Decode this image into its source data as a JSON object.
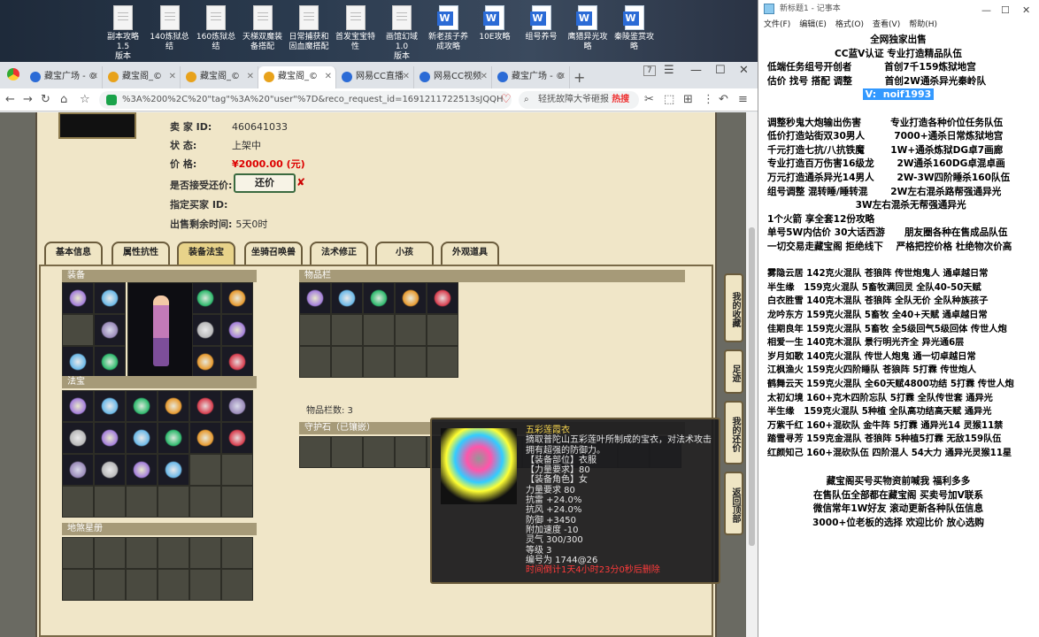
{
  "desktop_icons": [
    {
      "label": "副本攻略1.5\n版本",
      "type": "doc"
    },
    {
      "label": "140炼狱总结",
      "type": "doc"
    },
    {
      "label": "160炼狱总结",
      "type": "doc"
    },
    {
      "label": "天梯双魔装\n备搭配",
      "type": "doc"
    },
    {
      "label": "日常捕获和\n固血魔搭配",
      "type": "doc"
    },
    {
      "label": "首发宝宝特\n性",
      "type": "doc"
    },
    {
      "label": "画馆幻域1.0\n版本",
      "type": "doc"
    },
    {
      "label": "新老孩子养\n成攻略",
      "type": "word"
    },
    {
      "label": "10E攻略",
      "type": "word"
    },
    {
      "label": "组号养号",
      "type": "word"
    },
    {
      "label": "鹰猎异光攻\n略",
      "type": "word"
    },
    {
      "label": "秦陵鉴赏攻\n略",
      "type": "word"
    }
  ],
  "browser": {
    "tabs": [
      {
        "label": "藏宝广场 - ©",
        "active": false,
        "color": "#2b6bd6"
      },
      {
        "label": "藏宝阁_©",
        "active": false,
        "color": "#e8a21b"
      },
      {
        "label": "藏宝阁_©",
        "active": false,
        "color": "#e8a21b"
      },
      {
        "label": "藏宝阁_©",
        "active": true,
        "color": "#e8a21b"
      },
      {
        "label": "网易CC直播",
        "active": false,
        "color": "#2b6bd6"
      },
      {
        "label": "网易CC视频",
        "active": false,
        "color": "#2b6bd6"
      },
      {
        "label": "藏宝广场 - ©",
        "active": false,
        "color": "#2b6bd6"
      }
    ],
    "url": "%3A%200%2C%20\"tag\"%3A%20\"user\"%7D&reco_request_id=1691211722513sJQQH",
    "search_placeholder": "轻抚故障大爷砸报",
    "search_hot": "热搜",
    "counter": "7"
  },
  "listing": {
    "seller_label": "卖 家 ID:",
    "seller_id": "460641033",
    "status_label": "状 态:",
    "status": "上架中",
    "price_label": "价 格:",
    "price": "¥2000.00 (元)",
    "counter_label": "是否接受还价:",
    "counter_button": "还价",
    "buyer_label": "指定买家 ID:",
    "time_label": "出售剩余时间:",
    "time_left": "5天0时"
  },
  "game_tabs": [
    "基本信息",
    "属性抗性",
    "装备法宝",
    "坐骑召唤兽",
    "法术修正",
    "小孩",
    "外观道具"
  ],
  "active_tab": 2,
  "sections": {
    "equip": "装备",
    "fabao": "法宝",
    "jiyuan": "地煞星册",
    "items": "物品栏",
    "slot_count": "物品栏数: 3",
    "guard": "守护石（已镶嵌）"
  },
  "tooltip": {
    "name": "五彩莲霞衣",
    "desc": "摘取普陀山五彩莲叶所制成的宝衣，对法术攻击拥有超强的防御力。",
    "lines": [
      "【装备部位】衣服",
      "【力量要求】80",
      "【装备角色】女",
      "力量要求 80",
      "抗雷 +24.0%",
      "抗风 +24.0%",
      "防御 +3450",
      "附加速度 -10",
      "灵气 300/300",
      "等级 3",
      "编号为 1744@26"
    ],
    "timer": "时间倒计1天4小时23分0秒后删除"
  },
  "side_buttons": [
    "我的收藏",
    "足迹",
    "我的还价",
    "返回顶部"
  ],
  "notepad": {
    "title": "新标题1 - 记事本",
    "menu": [
      "文件(F)",
      "编辑(E)",
      "格式(O)",
      "查看(V)",
      "帮助(H)"
    ],
    "lines": [
      "全网独家出售",
      "CC蓝V认证 专业打造精品队伍",
      "低端任务组号开创者          首创7千159炼狱地宫",
      "估价 找号 搭配 调整          首创2W通杀异光秦岭队",
      "V:  noif1993",
      "",
      "调整秒鬼大炮输出伤害         专业打造各种价位任务队伍",
      "低价打造站街双30男人         7000+通杀日常炼狱地宫",
      "千元打造七抗/八抗铁魔        1W+通杀炼狱DG卓7画廊",
      "专业打造百万伤害16级龙       2W通杀160DG卓混卓画",
      "万元打造通杀异光14男人       2W-3W四阶睡杀160队伍",
      "组号调整 混转睡/睡转混       2W左右混杀路帮强通异光",
      "                           3W左右混杀无帮强通异光",
      "1个火箭 享全套12份攻略",
      "单号5W内估价 30大话西游      朋友圈各种在售成品队伍",
      "一切交易走藏宝阁 拒绝线下    严格把控价格 杜绝物次价高",
      "",
      "雾隐云居 142克火混队 苍狼阵 传世炮鬼人 通卓越日常",
      "半生缘   159克火混队 5畜牧满回灵 全队40-50天赋",
      "白衣胜雪 140克木混队 苍狼阵 全队无价 全队种族孩子",
      "龙吟东方 159克火混队 5畜牧 全40+天赋 通卓越日常",
      "佳期良年 159克火混队 5畜牧 全5级回气5级回体 传世人炮",
      "相爱一生 140克木混队 景行明光齐全 异光通6层",
      "岁月如歌 140克火混队 传世人炮鬼 通一切卓越日常",
      "江枫渔火 159克火四阶睡队 苍狼阵 5打霖 传世炮人",
      "鹤舞云天 159克火混队 全60天赋4800功结 5打霖 传世人炮",
      "太初幻境 160+克木四阶忘队 5打霖 全队传世套 通异光",
      "半生缘   159克火混队 5种植 全队高功结高天赋 通异光",
      "万紫千红 160+混砍队 金牛阵 5打霖 通异光14 灵猴11禁",
      "踏雪寻芳 159克金混队 苍狼阵 5种植5打霖 无敌159队伍",
      "红颜知己 160+混砍队伍 四阶混人 54大力 通异光灵猴11星",
      "",
      "藏宝阁买号买物资前喊我 福利多多",
      "在售队伍全部都在藏宝阁 买卖号加V联系",
      "微信常年1W好友 滚动更新各种队伍信息",
      "3000+位老板的选择 欢迎比价 放心选购"
    ]
  }
}
